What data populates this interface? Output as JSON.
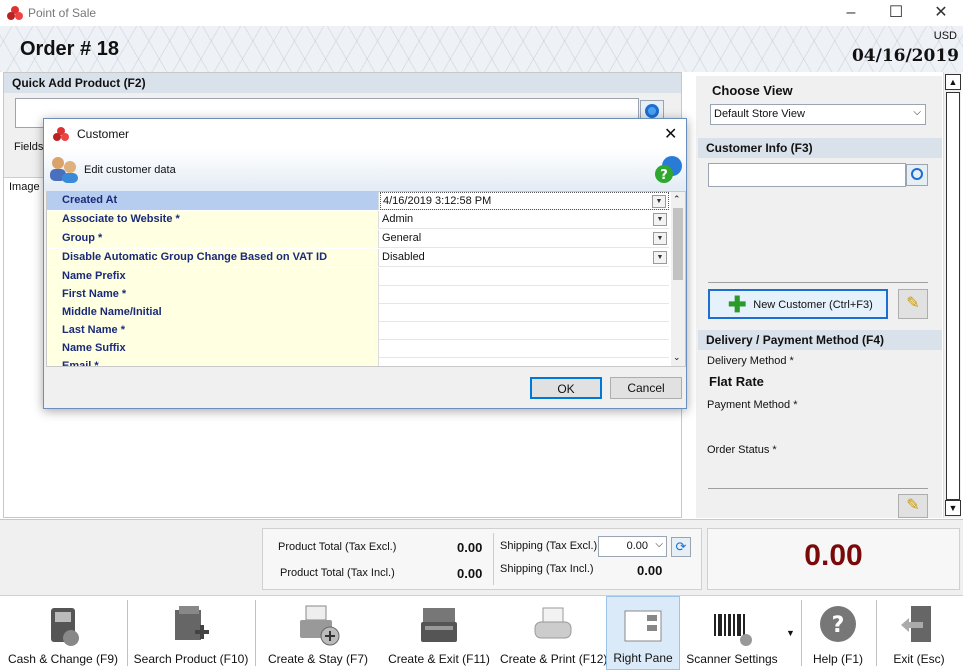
{
  "window": {
    "title": "Point of Sale"
  },
  "header": {
    "order_title": "Order # 18",
    "currency": "USD",
    "date": "04/16/2019"
  },
  "quick_add": {
    "label": "Quick Add Product (F2)",
    "value": "",
    "fields_label": "Fields",
    "image_col": "Image"
  },
  "right": {
    "choose_view_label": "Choose View",
    "view_selected": "Default Store View",
    "customer_info_label": "Customer Info (F3)",
    "new_customer_label": "New Customer (Ctrl+F3)",
    "delivery_label": "Delivery / Payment Method (F4)",
    "delivery_method_label": "Delivery Method *",
    "delivery_method_value": "Flat Rate",
    "payment_method_label": "Payment Method *",
    "order_status_label": "Order Status *"
  },
  "totals": {
    "product_total_excl_label": "Product Total (Tax Excl.)",
    "product_total_excl": "0.00",
    "product_total_incl_label": "Product Total (Tax Incl.)",
    "product_total_incl": "0.00",
    "shipping_excl_label": "Shipping (Tax Excl.)",
    "shipping_excl": "0.00",
    "shipping_incl_label": "Shipping (Tax Incl.)",
    "shipping_incl": "0.00",
    "grand_total": "0.00"
  },
  "toolbar": {
    "cash": "Cash & Change (F9)",
    "search": "Search Product (F10)",
    "create_stay": "Create & Stay (F7)",
    "create_exit": "Create & Exit (F11)",
    "create_print": "Create & Print (F12)",
    "right_pane": "Right Pane",
    "scanner": "Scanner Settings",
    "help": "Help (F1)",
    "exit": "Exit (Esc)"
  },
  "dialog": {
    "title": "Customer",
    "subtitle": "Edit customer data",
    "rows": [
      {
        "name": "Created At",
        "value": "4/16/2019 3:12:58 PM"
      },
      {
        "name": "Associate to Website *",
        "value": "Admin"
      },
      {
        "name": "Group *",
        "value": "General"
      },
      {
        "name": "Disable Automatic Group Change Based on VAT ID",
        "value": "Disabled"
      },
      {
        "name": "Name Prefix",
        "value": ""
      },
      {
        "name": "First Name *",
        "value": ""
      },
      {
        "name": "Middle Name/Initial",
        "value": ""
      },
      {
        "name": "Last Name *",
        "value": ""
      },
      {
        "name": "Name Suffix",
        "value": ""
      },
      {
        "name": "Email *",
        "value": ""
      }
    ],
    "ok": "OK",
    "cancel": "Cancel"
  },
  "colors": {
    "accent": "#1c6ed0",
    "grand_total": "#7a0a0a",
    "grid_label_bg": "#ffffe1",
    "grid_label_text": "#1a2a7a",
    "selected_row": "#b7cdf0"
  }
}
